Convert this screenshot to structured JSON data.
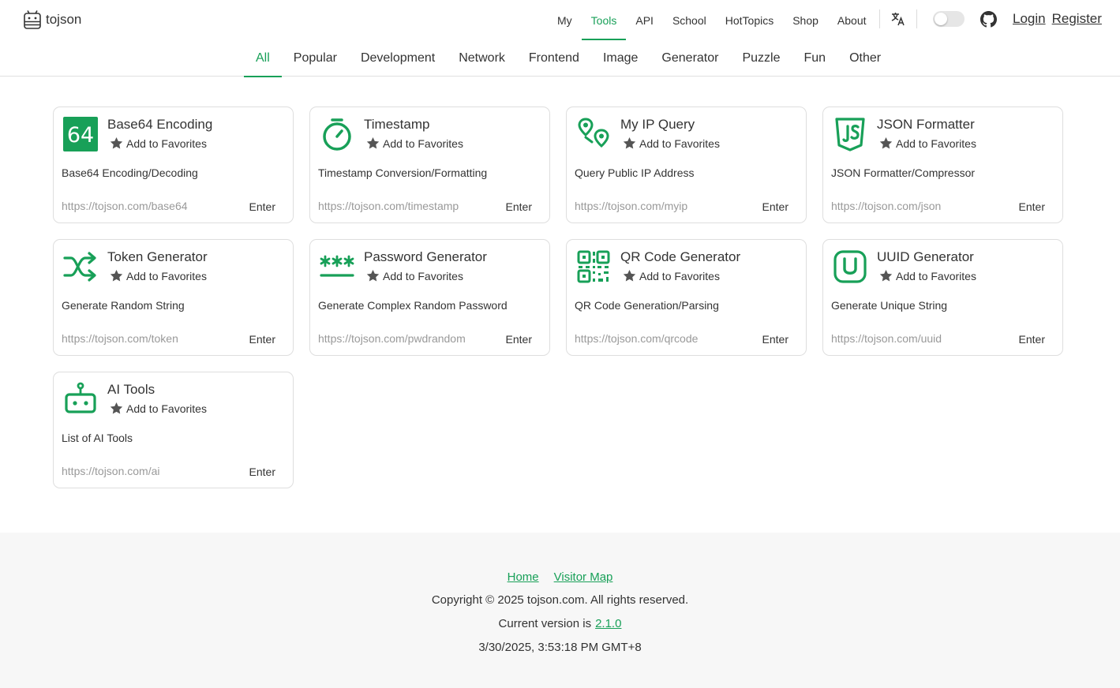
{
  "brand": {
    "name": "tojson"
  },
  "colors": {
    "accent": "#18a058",
    "border": "#dedede",
    "muted": "#999999"
  },
  "top_nav": [
    {
      "label": "My",
      "active": false
    },
    {
      "label": "Tools",
      "active": true
    },
    {
      "label": "API",
      "active": false
    },
    {
      "label": "School",
      "active": false
    },
    {
      "label": "HotTopics",
      "active": false
    },
    {
      "label": "Shop",
      "active": false
    },
    {
      "label": "About",
      "active": false
    }
  ],
  "auth": {
    "login": "Login",
    "register": "Register"
  },
  "categories": [
    {
      "label": "All",
      "active": true
    },
    {
      "label": "Popular"
    },
    {
      "label": "Development"
    },
    {
      "label": "Network"
    },
    {
      "label": "Frontend"
    },
    {
      "label": "Image"
    },
    {
      "label": "Generator"
    },
    {
      "label": "Puzzle"
    },
    {
      "label": "Fun"
    },
    {
      "label": "Other"
    }
  ],
  "favorite_label": "Add to Favorites",
  "enter_label": "Enter",
  "tools": [
    {
      "name": "Base64 Encoding",
      "icon": "base64-icon",
      "icon_text": "64",
      "description": "Base64 Encoding/Decoding",
      "url": "https://tojson.com/base64"
    },
    {
      "name": "Timestamp",
      "icon": "stopwatch-icon",
      "description": "Timestamp Conversion/Formatting",
      "url": "https://tojson.com/timestamp"
    },
    {
      "name": "My IP Query",
      "icon": "map-pin-icon",
      "description": "Query Public IP Address",
      "url": "https://tojson.com/myip"
    },
    {
      "name": "JSON Formatter",
      "icon": "js-shield-icon",
      "description": "JSON Formatter/Compressor",
      "url": "https://tojson.com/json"
    },
    {
      "name": "Token Generator",
      "icon": "shuffle-icon",
      "description": "Generate Random String",
      "url": "https://tojson.com/token"
    },
    {
      "name": "Password Generator",
      "icon": "password-icon",
      "description": "Generate Complex Random Password",
      "url": "https://tojson.com/pwdrandom"
    },
    {
      "name": "QR Code Generator",
      "icon": "qr-code-icon",
      "description": "QR Code Generation/Parsing",
      "url": "https://tojson.com/qrcode"
    },
    {
      "name": "UUID Generator",
      "icon": "uuid-icon",
      "description": "Generate Unique String",
      "url": "https://tojson.com/uuid"
    },
    {
      "name": "AI Tools",
      "icon": "robot-icon",
      "description": "List of AI Tools",
      "url": "https://tojson.com/ai"
    }
  ],
  "footer": {
    "links": [
      "Home",
      "Visitor Map"
    ],
    "copyright": "Copyright © 2025 tojson.com. All rights reserved.",
    "version_prefix": "Current version is",
    "version": "2.1.0",
    "datetime": "3/30/2025, 3:53:18 PM GMT+8"
  }
}
